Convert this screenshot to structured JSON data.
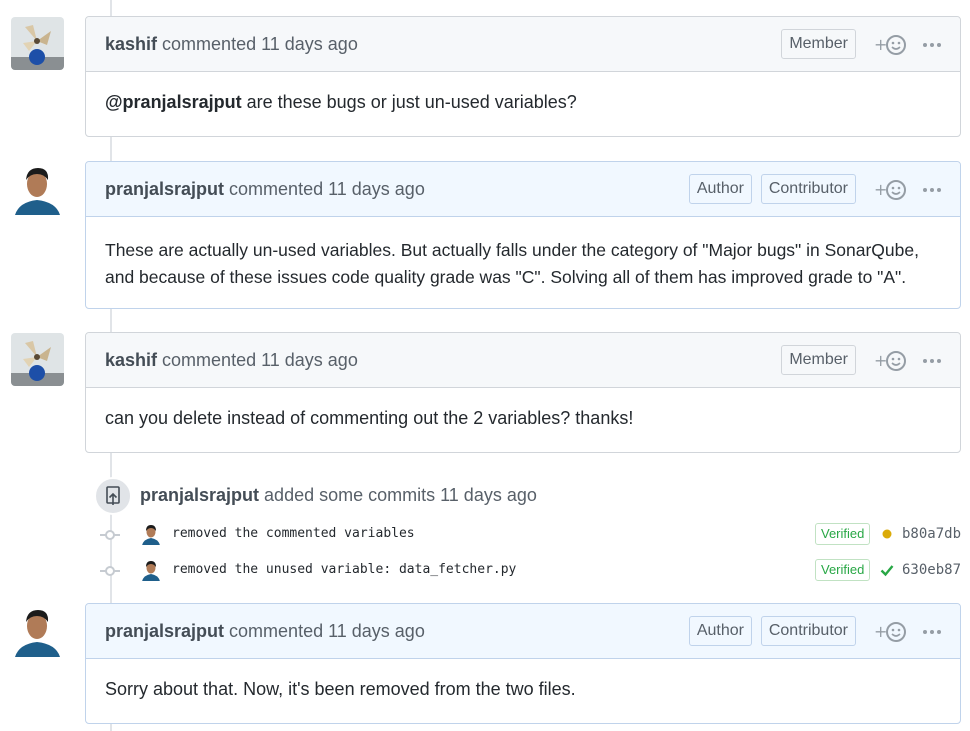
{
  "comments": [
    {
      "user": "kashif",
      "action": "commented 11 days ago",
      "badges": [
        "Member"
      ],
      "mention": "@pranjalsrajput",
      "body": "are these bugs or just un-used variables?"
    },
    {
      "user": "pranjalsrajput",
      "action": "commented 11 days ago",
      "badges": [
        "Author",
        "Contributor"
      ],
      "body_line1": "These are actually un-used variables. But actually falls under the category of \"Major bugs\" in SonarQube,",
      "body_line2": "and because of these issues code quality grade was \"C\". Solving all of them has improved grade to \"A\"."
    },
    {
      "user": "kashif",
      "action": "commented 11 days ago",
      "badges": [
        "Member"
      ],
      "body": "can you delete instead of commenting out the 2 variables? thanks!"
    },
    {
      "user": "pranjalsrajput",
      "action": "commented 11 days ago",
      "badges": [
        "Author",
        "Contributor"
      ],
      "body": "Sorry about that. Now, it's been removed from the two files."
    }
  ],
  "commit_event": {
    "user": "pranjalsrajput",
    "action": "added some commits 11 days ago",
    "commits": [
      {
        "message": "removed the commented variables",
        "verified": "Verified",
        "status": "pending",
        "sha": "b80a7db"
      },
      {
        "message": "removed the unused variable: data_fetcher.py",
        "verified": "Verified",
        "status": "success",
        "sha": "630eb87"
      }
    ]
  },
  "colors": {
    "author_header": "#f1f8ff",
    "author_border": "#c0d3eb",
    "pending": "#dbab09",
    "success": "#28a745"
  },
  "icons": {
    "reaction": "smiley-plus-icon",
    "more": "kebab-horizontal-icon",
    "commit_event": "repo-push-icon",
    "commit_node": "git-commit-icon"
  }
}
